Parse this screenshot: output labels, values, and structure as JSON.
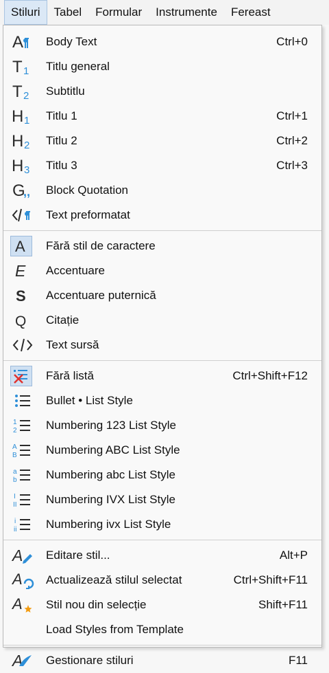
{
  "menubar": {
    "items": [
      "Stiluri",
      "Tabel",
      "Formular",
      "Instrumente",
      "Fereast"
    ]
  },
  "menu": {
    "paragraph_styles": [
      {
        "label": "Body Text",
        "shortcut": "Ctrl+0",
        "icon": "body-text-icon"
      },
      {
        "label": "Titlu general",
        "shortcut": "",
        "icon": "title-icon"
      },
      {
        "label": "Subtitlu",
        "shortcut": "",
        "icon": "subtitle-icon"
      },
      {
        "label": "Titlu 1",
        "shortcut": "Ctrl+1",
        "icon": "heading-1-icon"
      },
      {
        "label": "Titlu 2",
        "shortcut": "Ctrl+2",
        "icon": "heading-2-icon"
      },
      {
        "label": "Titlu 3",
        "shortcut": "Ctrl+3",
        "icon": "heading-3-icon"
      },
      {
        "label": "Block Quotation",
        "shortcut": "",
        "icon": "block-quotation-icon"
      },
      {
        "label": "Text preformatat",
        "shortcut": "",
        "icon": "preformatted-text-icon"
      }
    ],
    "character_styles": [
      {
        "label": "Fără stil de caractere",
        "shortcut": "",
        "icon": "no-character-style-icon"
      },
      {
        "label": "Accentuare",
        "shortcut": "",
        "icon": "emphasis-icon"
      },
      {
        "label": "Accentuare puternică",
        "shortcut": "",
        "icon": "strong-emphasis-icon"
      },
      {
        "label": "Citație",
        "shortcut": "",
        "icon": "quotation-icon"
      },
      {
        "label": "Text sursă",
        "shortcut": "",
        "icon": "source-text-icon"
      }
    ],
    "list_styles": [
      {
        "label": "Fără listă",
        "shortcut": "Ctrl+Shift+F12",
        "icon": "no-list-icon"
      },
      {
        "label": "Bullet • List Style",
        "shortcut": "",
        "icon": "bullet-list-icon"
      },
      {
        "label": "Numbering 123 List Style",
        "shortcut": "",
        "icon": "numbering-123-icon"
      },
      {
        "label": "Numbering ABC List Style",
        "shortcut": "",
        "icon": "numbering-abc-upper-icon"
      },
      {
        "label": "Numbering abc List Style",
        "shortcut": "",
        "icon": "numbering-abc-lower-icon"
      },
      {
        "label": "Numbering IVX List Style",
        "shortcut": "",
        "icon": "numbering-ivx-upper-icon"
      },
      {
        "label": "Numbering ivx List Style",
        "shortcut": "",
        "icon": "numbering-ivx-lower-icon"
      }
    ],
    "style_actions": [
      {
        "label": "Editare stil...",
        "shortcut": "Alt+P",
        "icon": "edit-style-icon"
      },
      {
        "label": "Actualizează stilul selectat",
        "shortcut": "Ctrl+Shift+F11",
        "icon": "update-style-icon"
      },
      {
        "label": "Stil nou din selecție",
        "shortcut": "Shift+F11",
        "icon": "new-style-icon"
      },
      {
        "label": "Load Styles from Template",
        "shortcut": "",
        "icon": ""
      }
    ],
    "manage": [
      {
        "label": "Gestionare stiluri",
        "shortcut": "F11",
        "icon": "manage-styles-icon"
      }
    ]
  },
  "colors": {
    "accent": "#1f8ad6",
    "icon_blue": "#2e8fd8",
    "icon_dark": "#2b2b2b",
    "red": "#e0322f",
    "orange": "#f39c12"
  }
}
